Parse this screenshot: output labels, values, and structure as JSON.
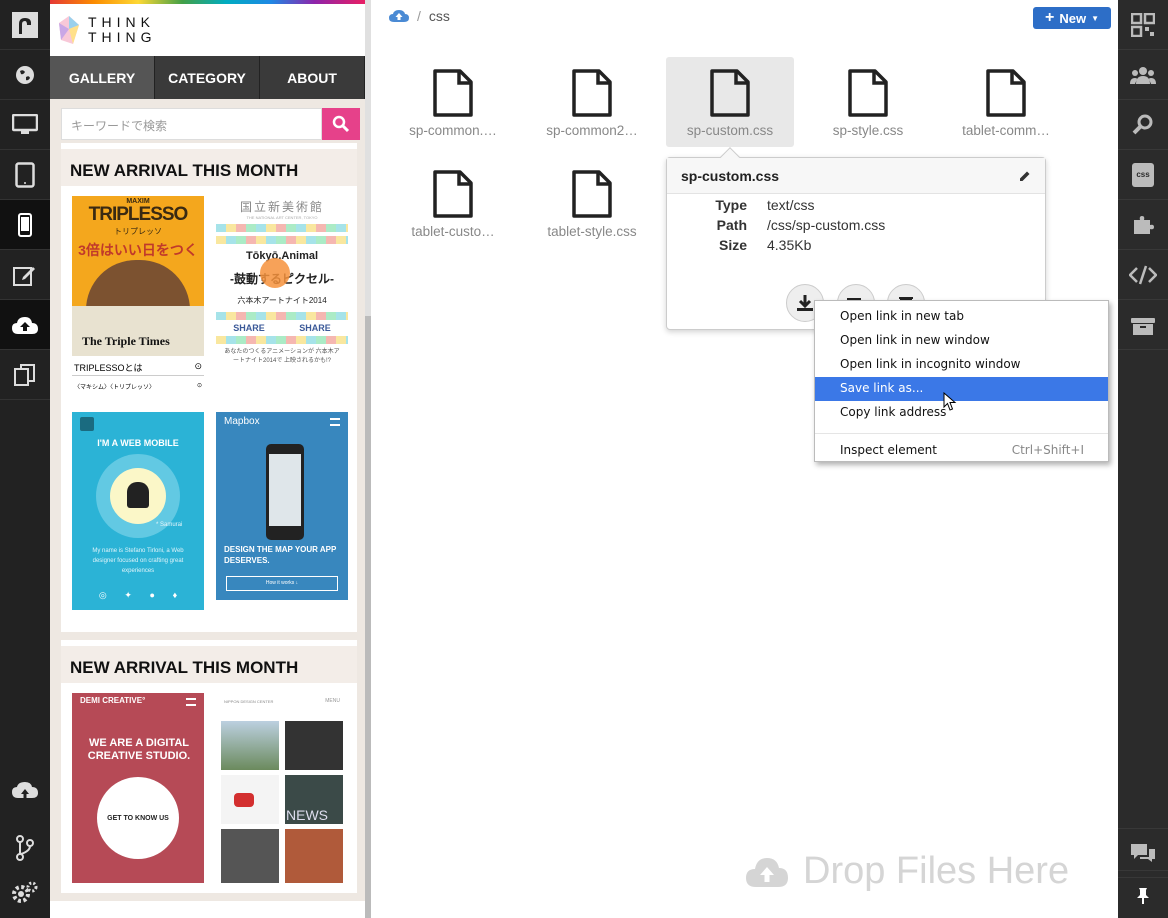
{
  "left_toolbar": {
    "items": [
      {
        "icon": "logo-icon"
      },
      {
        "icon": "globe-icon"
      },
      {
        "icon": "desktop-icon"
      },
      {
        "icon": "tablet-icon"
      },
      {
        "icon": "phone-icon"
      },
      {
        "icon": "edit-icon"
      },
      {
        "icon": "cloud-upload-icon"
      },
      {
        "icon": "copy-icon"
      },
      {
        "icon": "deploy-icon"
      },
      {
        "icon": "branch-icon"
      },
      {
        "icon": "settings-icon"
      }
    ]
  },
  "preview": {
    "logo_line1": "THINK",
    "logo_line2": "THING",
    "nav": [
      "GALLERY",
      "CATEGORY",
      "ABOUT"
    ],
    "search_placeholder": "キーワードで検索",
    "sections": [
      {
        "title": "NEW ARRIVAL THIS MONTH"
      },
      {
        "title": "NEW ARRIVAL THIS MONTH"
      }
    ],
    "tiles": {
      "maxim": "MAXIM",
      "tripl": "TRIPLESSO",
      "tripl_jp": "トリプレッソ",
      "tripl_tag": "3倍はいい日をつくる。",
      "triple_times": "The Triple Times",
      "tripl_about": "TRIPLESSOとは",
      "tripl_sub": "〈マキシム〉〈トリプレッソ〉",
      "art_center": "国立新美術館",
      "art_center_sub": "THE NATIONAL ART CENTER, TOKYO",
      "tokyo_animal": "Tōkyō.Animal",
      "pixel": "-鼓動するピクセル-",
      "roppongi": "六本木アートナイト2014",
      "share1": "SHARE",
      "share2": "SHARE",
      "art_text": "あなたのつくるアニメーションが 六本木アートナイト2014で 上映されるかも!?",
      "mobile_title": "I'M A WEB MOBILE",
      "samurai": "* Samurai",
      "mobile_desc": "My name is Stefano Tirloni, a Web designer focused on crafting great experiences",
      "mapbox": "Mapbox",
      "mapbox_headline": "DESIGN THE MAP YOUR APP DESERVES.",
      "mapbox_btn": "How it works ↓",
      "demi": "DEMI CREATIVE°",
      "demi_headline": "WE ARE A DIGITAL CREATIVE STUDIO.",
      "demi_btn": "GET TO KNOW US",
      "nippon": "NIPPON DESIGN CENTER",
      "menu": "MENU",
      "news": "NEWS"
    }
  },
  "breadcrumb": {
    "sep": "/",
    "folder": "css"
  },
  "new_button": "New",
  "files": [
    {
      "name": "sp-common.…"
    },
    {
      "name": "sp-common2…"
    },
    {
      "name": "sp-custom.css",
      "selected": true
    },
    {
      "name": "sp-style.css"
    },
    {
      "name": "tablet-comm…"
    },
    {
      "name": "tablet-custo…"
    },
    {
      "name": "tablet-style.css"
    }
  ],
  "popover": {
    "title": "sp-custom.css",
    "type_label": "Type",
    "type_value": "text/css",
    "path_label": "Path",
    "path_value": "/css/sp-custom.css",
    "size_label": "Size",
    "size_value": "4.35Kb"
  },
  "context_menu": {
    "items": [
      "Open link in new tab",
      "Open link in new window",
      "Open link in incognito window",
      "Save link as...",
      "Copy link address"
    ],
    "inspect": "Inspect element",
    "inspect_shortcut": "Ctrl+Shift+I"
  },
  "drop_zone": "Drop Files Here",
  "right_toolbar": {
    "items": [
      {
        "icon": "qr-code-icon"
      },
      {
        "icon": "users-icon"
      },
      {
        "icon": "search-icon"
      },
      {
        "icon": "css-icon",
        "label": "css"
      },
      {
        "icon": "puzzle-icon"
      },
      {
        "icon": "code-icon"
      },
      {
        "icon": "archive-icon"
      },
      {
        "icon": "chat-icon"
      },
      {
        "icon": "pin-icon"
      }
    ]
  },
  "colors": {
    "accent": "#2d6ec7",
    "pink": "#e6418a",
    "highlight": "#3b78e7"
  }
}
